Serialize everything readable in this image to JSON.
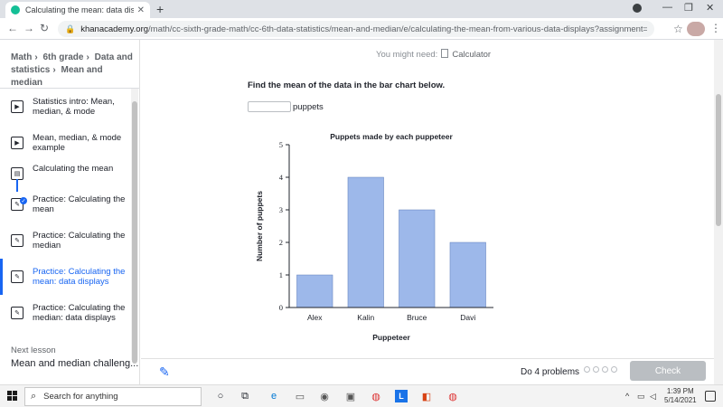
{
  "browser": {
    "tab_title": "Calculating the mean: data disp",
    "url_domain": "khanacademy.org",
    "url_path": "/math/cc-sixth-grade-math/cc-6th-data-statistics/mean-and-median/e/calculating-the-mean-from-various-data-displays?assignment=ag5zfmtoYW..."
  },
  "breadcrumb": {
    "items": [
      "Math",
      "6th grade",
      "Data and statistics",
      "Mean and median"
    ]
  },
  "sidebar": {
    "items": [
      {
        "label": "Statistics intro: Mean, median, & mode",
        "icon": "play-icon"
      },
      {
        "label": "Mean, median, & mode example",
        "icon": "play-icon"
      },
      {
        "label": "Calculating the mean",
        "icon": "article-icon"
      },
      {
        "label": "Practice: Calculating the mean",
        "icon": "pencil-icon"
      },
      {
        "label": "Practice: Calculating the median",
        "icon": "pencil-icon"
      },
      {
        "label": "Practice: Calculating the mean: data displays",
        "icon": "pencil-icon"
      },
      {
        "label": "Practice: Calculating the median: data displays",
        "icon": "pencil-icon"
      }
    ],
    "active_index": 5,
    "next_lesson_title": "Next lesson",
    "next_lesson_name": "Mean and median challeng..."
  },
  "exercise": {
    "might_need": "You might need:",
    "tool": "Calculator",
    "prompt": "Find the mean of the data in the bar chart below.",
    "answer_value": "",
    "unit": "puppets"
  },
  "chart_data": {
    "type": "bar",
    "title": "Puppets made by each puppeteer",
    "xlabel": "Puppeteer",
    "ylabel": "Number of puppets",
    "categories": [
      "Alex",
      "Kalin",
      "Bruce",
      "Davi"
    ],
    "values": [
      1,
      4,
      3,
      2
    ],
    "ylim": [
      0,
      5
    ],
    "yticks": [
      "0",
      "1",
      "2",
      "3",
      "4",
      "5"
    ],
    "bar_color": "#9db8ea",
    "bar_edge": "#5a7bb8",
    "grid": false
  },
  "footer": {
    "do_label": "Do 4 problems",
    "problem_count": 4,
    "check_label": "Check"
  },
  "taskbar": {
    "search_placeholder": "Search for anything",
    "time": "1:39 PM",
    "date": "5/14/2021"
  },
  "colors": {
    "accent": "#1865f2",
    "check_disabled": "#babec2"
  }
}
